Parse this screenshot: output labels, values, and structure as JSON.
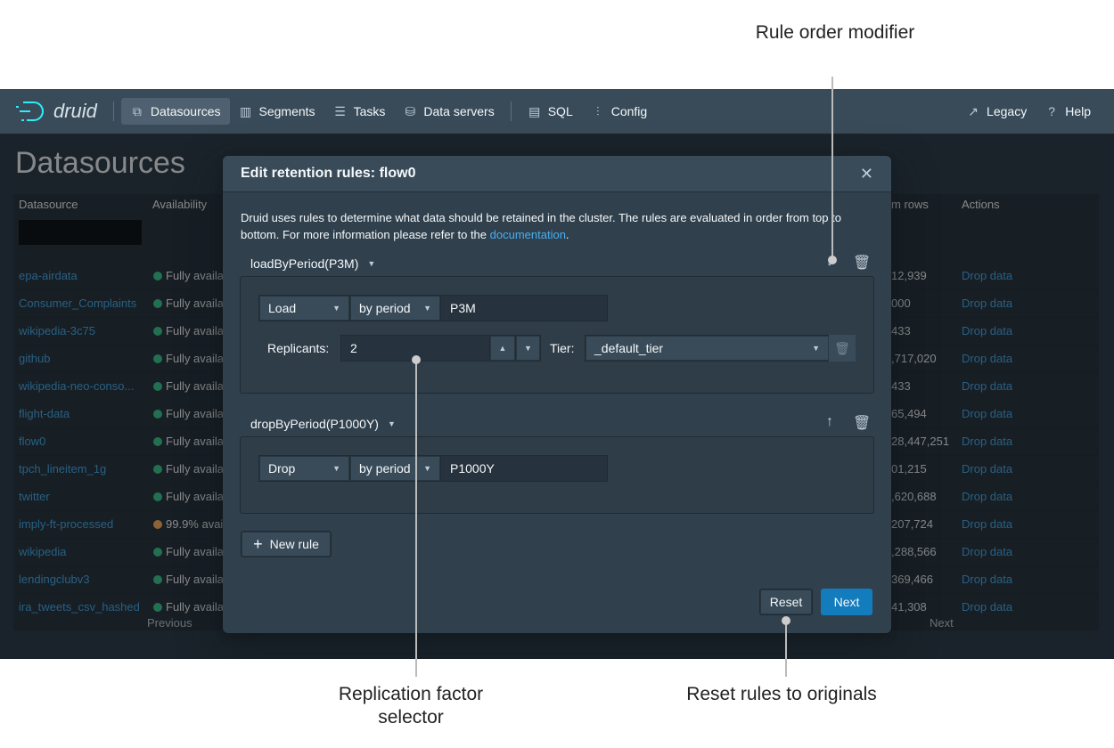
{
  "annotations": {
    "rule_order": "Rule order modifier",
    "replication": "Replication factor selector",
    "reset": "Reset rules to originals"
  },
  "nav": {
    "logo": "druid",
    "items": [
      {
        "label": "Datasources",
        "icon": "datasources-icon",
        "active": true
      },
      {
        "label": "Segments",
        "icon": "segments-icon"
      },
      {
        "label": "Tasks",
        "icon": "tasks-icon"
      },
      {
        "label": "Data servers",
        "icon": "database-icon"
      },
      {
        "label": "SQL",
        "icon": "sql-icon"
      },
      {
        "label": "Config",
        "icon": "sliders-icon"
      }
    ],
    "legacy": "Legacy",
    "help": "Help"
  },
  "page": {
    "title": "Datasources",
    "columns": [
      "Datasource",
      "Availability",
      "m rows",
      "Actions"
    ],
    "rows": [
      {
        "name": "epa-airdata",
        "avail": "Fully availa",
        "status": "green",
        "rows": "12,939",
        "action": "Drop data"
      },
      {
        "name": "Consumer_Complaints",
        "avail": "Fully availa",
        "status": "green",
        "rows": "000",
        "action": "Drop data"
      },
      {
        "name": "wikipedia-3c75",
        "avail": "Fully availa",
        "status": "green",
        "rows": "433",
        "action": "Drop data"
      },
      {
        "name": "github",
        "avail": "Fully availa",
        "status": "green",
        "rows": ",717,020",
        "action": "Drop data"
      },
      {
        "name": "wikipedia-neo-conso...",
        "avail": "Fully availa",
        "status": "green",
        "rows": "433",
        "action": "Drop data"
      },
      {
        "name": "flight-data",
        "avail": "Fully availa",
        "status": "green",
        "rows": "65,494",
        "action": "Drop data"
      },
      {
        "name": "flow0",
        "avail": "Fully availa",
        "status": "green",
        "rows": "28,447,251",
        "action": "Drop data"
      },
      {
        "name": "tpch_lineitem_1g",
        "avail": "Fully availa",
        "status": "green",
        "rows": "01,215",
        "action": "Drop data"
      },
      {
        "name": "twitter",
        "avail": "Fully availa",
        "status": "green",
        "rows": ",620,688",
        "action": "Drop data"
      },
      {
        "name": "imply-ft-processed",
        "avail": "99.9% avai",
        "status": "orange",
        "rows": "207,724",
        "action": "Drop data"
      },
      {
        "name": "wikipedia",
        "avail": "Fully availa",
        "status": "green",
        "rows": ",288,566",
        "action": "Drop data"
      },
      {
        "name": "lendingclubv3",
        "avail": "Fully availa",
        "status": "green",
        "rows": "369,466",
        "action": "Drop data"
      },
      {
        "name": "ira_tweets_csv_hashed",
        "avail": "Fully availa",
        "status": "green",
        "rows": "41,308",
        "action": "Drop data"
      }
    ],
    "previous": "Previous",
    "next": "Next"
  },
  "dialog": {
    "title": "Edit retention rules: flow0",
    "desc": "Druid uses rules to determine what data should be retained in the cluster. The rules are evaluated in order from top to bottom. For more information please refer to the ",
    "desc_link": "documentation",
    "desc_end": ".",
    "rules": [
      {
        "name": "loadByPeriod(P3M)",
        "type": "Load",
        "mode": "by period",
        "period": "P3M",
        "replicants_label": "Replicants:",
        "replicants": "2",
        "tier_label": "Tier:",
        "tier": "_default_tier"
      },
      {
        "name": "dropByPeriod(P1000Y)",
        "type": "Drop",
        "mode": "by period",
        "period": "P1000Y"
      }
    ],
    "new_rule": "New rule",
    "reset": "Reset",
    "next": "Next"
  },
  "colors": {
    "accent": "#137cbd",
    "link": "#48aff0",
    "green": "#3dcc91",
    "orange": "#ffb366"
  }
}
